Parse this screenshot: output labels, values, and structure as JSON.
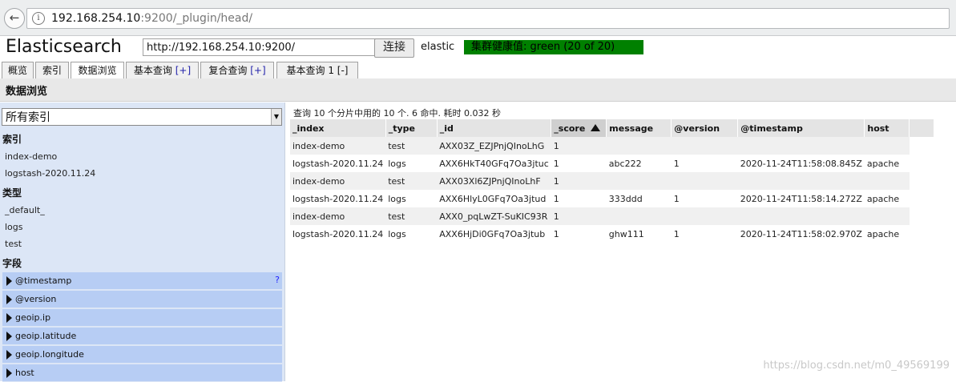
{
  "browser": {
    "url_host": "192.168.254.10",
    "url_rest": ":9200/_plugin/head/"
  },
  "header": {
    "title": "Elasticsearch",
    "cluster_url": "http://192.168.254.10:9200/",
    "connect_label": "连接",
    "cluster_name": "elastic",
    "health_text": "集群健康值: green (20 of 20)",
    "health_color": "#008000"
  },
  "tabs": [
    {
      "label": "概览"
    },
    {
      "label": "索引"
    },
    {
      "label": "数据浏览",
      "active": true
    },
    {
      "label": "基本查询",
      "suffix": "[+]"
    },
    {
      "label": "复合查询",
      "suffix": "[+]"
    },
    {
      "label": "基本查询 1",
      "suffix": "[-]"
    }
  ],
  "section_title": "数据浏览",
  "sidebar": {
    "index_select": "所有索引",
    "indices_header": "索引",
    "indices": [
      "index-demo",
      "logstash-2020.11.24"
    ],
    "types_header": "类型",
    "types": [
      "_default_",
      "logs",
      "test"
    ],
    "fields_header": "字段",
    "fields": [
      "@timestamp",
      "@version",
      "geoip.ip",
      "geoip.latitude",
      "geoip.longitude",
      "host"
    ],
    "help_icon": "?"
  },
  "results": {
    "summary": "查询 10 个分片中用的 10 个. 6 命中. 耗时 0.032 秒",
    "columns": [
      "_index",
      "_type",
      "_id",
      "_score",
      "message",
      "@version",
      "@timestamp",
      "host"
    ],
    "sorted_column": "_score",
    "rows": [
      [
        "index-demo",
        "test",
        "AXX03Z_EZJPnjQInoLhG",
        "1",
        "",
        "",
        "",
        ""
      ],
      [
        "logstash-2020.11.24",
        "logs",
        "AXX6HkT40GFq7Oa3jtuc",
        "1",
        "abc222",
        "1",
        "2020-11-24T11:58:08.845Z",
        "apache"
      ],
      [
        "index-demo",
        "test",
        "AXX03Xl6ZJPnjQInoLhF",
        "1",
        "",
        "",
        "",
        ""
      ],
      [
        "logstash-2020.11.24",
        "logs",
        "AXX6HlyL0GFq7Oa3jtud",
        "1",
        "333ddd",
        "1",
        "2020-11-24T11:58:14.272Z",
        "apache"
      ],
      [
        "index-demo",
        "test",
        "AXX0_pqLwZT-SuKIC93R",
        "1",
        "",
        "",
        "",
        ""
      ],
      [
        "logstash-2020.11.24",
        "logs",
        "AXX6HjDi0GFq7Oa3jtub",
        "1",
        "ghw111",
        "1",
        "2020-11-24T11:58:02.970Z",
        "apache"
      ]
    ]
  },
  "watermark": "https://blog.csdn.net/m0_49569199"
}
